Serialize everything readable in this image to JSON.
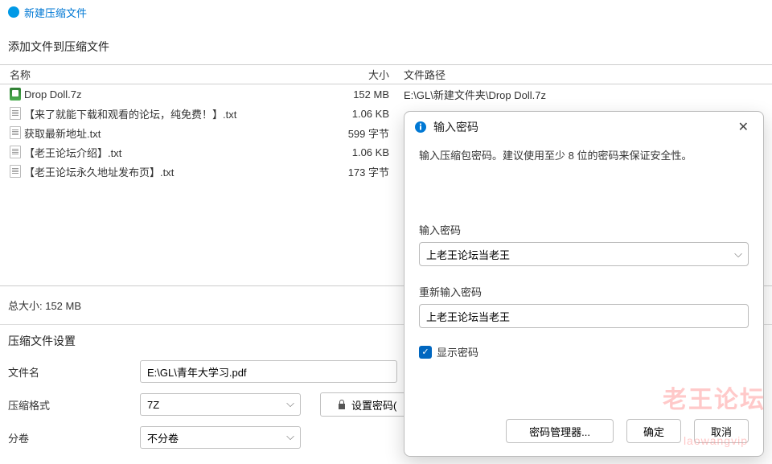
{
  "title": "新建压缩文件",
  "subtitle": "添加文件到压缩文件",
  "columns": {
    "name": "名称",
    "size": "大小",
    "path": "文件路径"
  },
  "files": [
    {
      "name": "Drop Doll.7z",
      "size": "152 MB",
      "path": "E:\\GL\\新建文件夹\\Drop Doll.7z",
      "type": "7z"
    },
    {
      "name": "【来了就能下载和观看的论坛，纯免费！】.txt",
      "size": "1.06 KB",
      "path": "",
      "type": "txt"
    },
    {
      "name": "获取最新地址.txt",
      "size": "599 字节",
      "path": "",
      "type": "txt"
    },
    {
      "name": "【老王论坛介绍】.txt",
      "size": "1.06 KB",
      "path": "",
      "type": "txt"
    },
    {
      "name": "【老王论坛永久地址发布页】.txt",
      "size": "173 字节",
      "path": "",
      "type": "txt"
    }
  ],
  "total_label": "总大小: 152 MB",
  "settings_label": "压缩文件设置",
  "form": {
    "filename_label": "文件名",
    "filename_value": "E:\\GL\\青年大学习.pdf",
    "format_label": "压缩格式",
    "format_value": "7Z",
    "password_button": "设置密码(",
    "split_label": "分卷",
    "split_value": "不分卷"
  },
  "dialog": {
    "title": "输入密码",
    "desc": "输入压缩包密码。建议使用至少 8 位的密码来保证安全性。",
    "pw_label": "输入密码",
    "pw_value": "上老王论坛当老王",
    "pw2_label": "重新输入密码",
    "pw2_value": "上老王论坛当老王",
    "show_pw_label": "显示密码",
    "btn_manager": "密码管理器...",
    "btn_ok": "确定",
    "btn_cancel": "取消"
  },
  "watermark": "老王论坛",
  "watermark2": "laowangvip"
}
